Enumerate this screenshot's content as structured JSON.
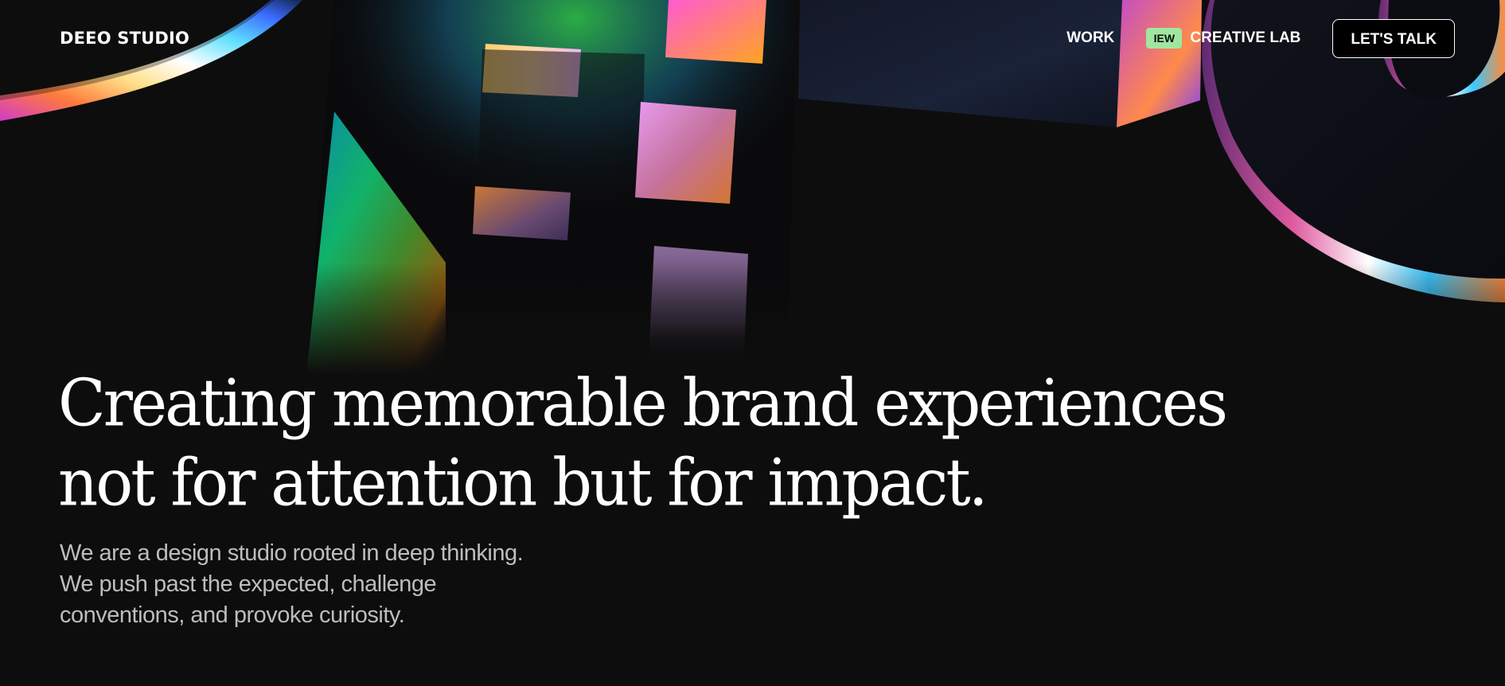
{
  "header": {
    "logo": "DEEO STUDIO",
    "nav": {
      "work": "WORK",
      "badge": "IEW",
      "creative_lab": "CREATIVE LAB",
      "cta": "LET'S TALK"
    }
  },
  "hero": {
    "title_lines": [
      "Creating memorable brand experiences",
      "not for attention but for impact."
    ],
    "text_lines": [
      "We are a design studio rooted in deep thinking.",
      "We push past the expected, challenge",
      "conventions, and provoke curiosity."
    ]
  },
  "colors": {
    "background": "#0d0d0d",
    "badge": "#9fe7a0",
    "text_muted": "#bdbdbd",
    "text_primary": "#ffffff"
  },
  "icons": {
    "art": "iridescent-3d-letterforms"
  }
}
